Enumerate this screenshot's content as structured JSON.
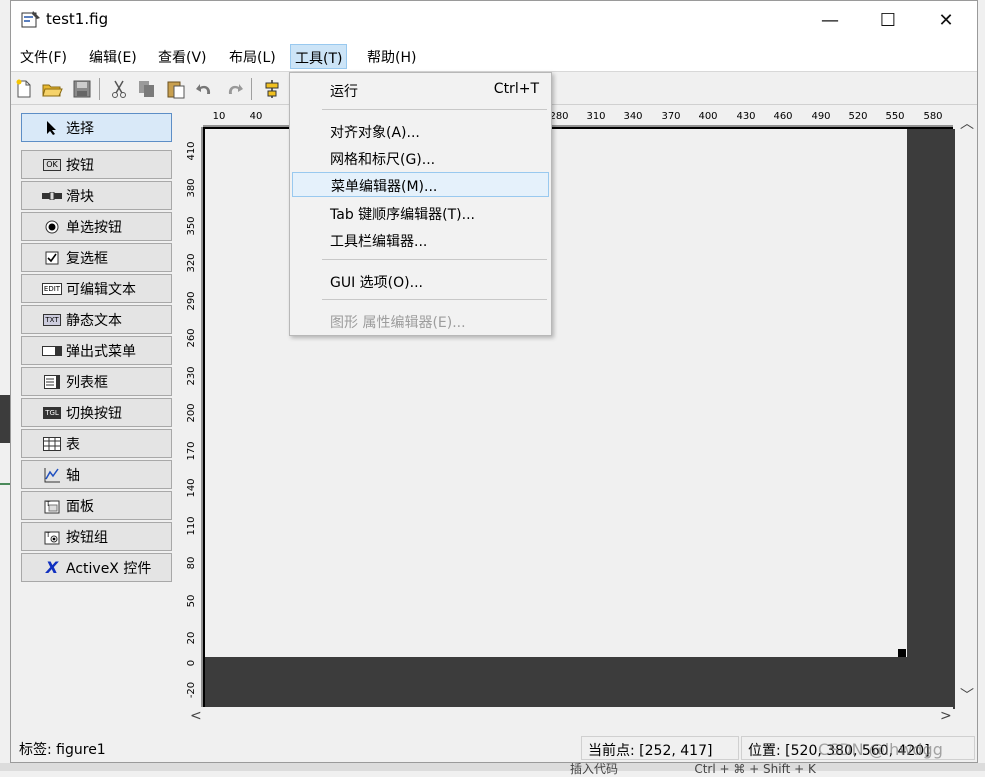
{
  "window": {
    "title": "test1.fig",
    "controls": {
      "minimize": "—",
      "maximize": "☐",
      "close": "✕"
    }
  },
  "menubar": [
    {
      "label": "文件(F)"
    },
    {
      "label": "编辑(E)"
    },
    {
      "label": "查看(V)"
    },
    {
      "label": "布局(L)"
    },
    {
      "label": "工具(T)",
      "active": true
    },
    {
      "label": "帮助(H)"
    }
  ],
  "toolbar": {
    "icons": [
      "new-file-icon",
      "open-folder-icon",
      "save-icon",
      "cut-icon",
      "copy-icon",
      "paste-icon",
      "undo-icon",
      "redo-icon",
      "align-icon"
    ]
  },
  "tools_menu": {
    "items": [
      {
        "label": "运行",
        "shortcut": "Ctrl+T"
      },
      {
        "label": "对齐对象(A)..."
      },
      {
        "label": "网格和标尺(G)..."
      },
      {
        "label": "菜单编辑器(M)...",
        "highlighted": true
      },
      {
        "label": "Tab 键顺序编辑器(T)..."
      },
      {
        "label": "工具栏编辑器..."
      },
      {
        "label": "GUI 选项(O)..."
      },
      {
        "label": "图形 属性编辑器(E)...",
        "disabled": true
      }
    ]
  },
  "palette": {
    "items": [
      {
        "label": "选择",
        "icon": "arrow-pointer-icon",
        "selected": true
      },
      {
        "label": "按钮",
        "icon": "push-button-icon",
        "badge": "OK"
      },
      {
        "label": "滑块",
        "icon": "slider-icon"
      },
      {
        "label": "单选按钮",
        "icon": "radio-button-icon"
      },
      {
        "label": "复选框",
        "icon": "checkbox-icon"
      },
      {
        "label": "可编辑文本",
        "icon": "edit-text-icon",
        "badge": "EDIT"
      },
      {
        "label": "静态文本",
        "icon": "static-text-icon",
        "badge": "TXT"
      },
      {
        "label": "弹出式菜单",
        "icon": "popup-menu-icon"
      },
      {
        "label": "列表框",
        "icon": "listbox-icon"
      },
      {
        "label": "切换按钮",
        "icon": "toggle-button-icon",
        "badge": "TGL"
      },
      {
        "label": "表",
        "icon": "table-icon"
      },
      {
        "label": "轴",
        "icon": "axes-icon"
      },
      {
        "label": "面板",
        "icon": "panel-icon"
      },
      {
        "label": "按钮组",
        "icon": "button-group-icon"
      },
      {
        "label": "ActiveX 控件",
        "icon": "activex-icon",
        "badge": "X"
      }
    ]
  },
  "ruler_top": [
    "10",
    "40",
    "280",
    "310",
    "340",
    "370",
    "400",
    "430",
    "460",
    "490",
    "520",
    "550",
    "580"
  ],
  "ruler_left": [
    "410",
    "380",
    "350",
    "320",
    "290",
    "260",
    "230",
    "200",
    "170",
    "140",
    "110",
    "80",
    "50",
    "20",
    "0",
    "-20"
  ],
  "status": {
    "tag": "标签: figure1",
    "current_point": "当前点:  [252, 417]",
    "position": "位置: [520, 380, 560, 420]"
  },
  "watermark": "CSDN @lhwdgg",
  "background_fragment": "插入代码",
  "background_fragment2": "Ctrl + ⌘ + Shift + K"
}
